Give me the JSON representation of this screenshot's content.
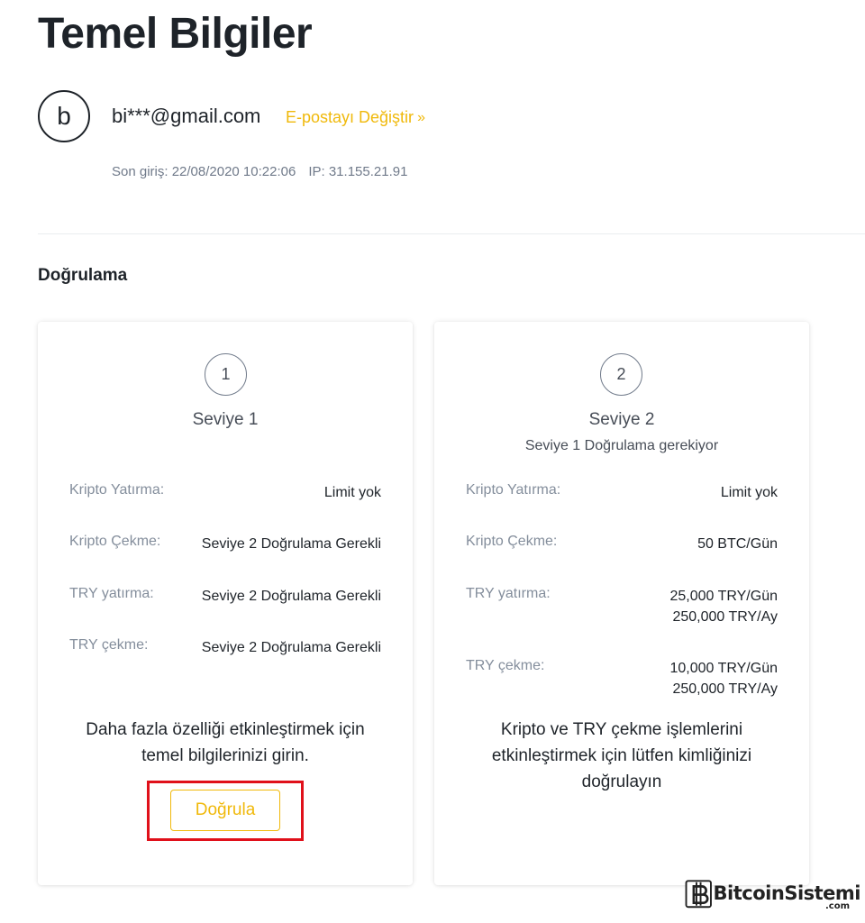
{
  "header": {
    "title": "Temel Bilgiler",
    "avatar_letter": "b",
    "email": "bi***@gmail.com",
    "change_email_label": "E-postayı Değiştir",
    "change_email_icon": "double-chevron-right-icon",
    "last_login": "Son giriş: 22/08/2020 10:22:06",
    "ip": "IP: 31.155.21.91"
  },
  "verification": {
    "section_title": "Doğrulama",
    "levels": [
      {
        "number": "1",
        "name": "Seviye 1",
        "subtitle": "",
        "rows": [
          {
            "label": "Kripto Yatırma:",
            "value": [
              "Limit yok"
            ]
          },
          {
            "label": "Kripto Çekme:",
            "value": [
              "Seviye 2 Doğrulama Gerekli"
            ]
          },
          {
            "label": "TRY yatırma:",
            "value": [
              "Seviye 2 Doğrulama Gerekli"
            ]
          },
          {
            "label": "TRY çekme:",
            "value": [
              "Seviye 2 Doğrulama Gerekli"
            ]
          }
        ],
        "description": [
          "Daha fazla özelliği etkinleştirmek için",
          "temel bilgilerinizi girin."
        ],
        "button_label": "Doğrula"
      },
      {
        "number": "2",
        "name": "Seviye 2",
        "subtitle": "Seviye 1 Doğrulama gerekiyor",
        "rows": [
          {
            "label": "Kripto Yatırma:",
            "value": [
              "Limit yok"
            ]
          },
          {
            "label": "Kripto Çekme:",
            "value": [
              "50 BTC/Gün"
            ]
          },
          {
            "label": "TRY yatırma:",
            "value": [
              "25,000 TRY/Gün",
              "250,000 TRY/Ay"
            ]
          },
          {
            "label": "TRY çekme:",
            "value": [
              "10,000 TRY/Gün",
              "250,000 TRY/Ay"
            ]
          }
        ],
        "description": [
          "Kripto ve TRY çekme işlemlerini",
          "etkinleştirmek için lütfen kimliğinizi",
          "doğrulayın"
        ]
      }
    ]
  },
  "watermark": {
    "text": "BitcoinSistemi",
    "suffix": ".com"
  },
  "colors": {
    "accent": "#f0b90b",
    "highlight_border": "#e0101a",
    "text_primary": "#1e2329",
    "text_secondary": "#848e9c"
  }
}
